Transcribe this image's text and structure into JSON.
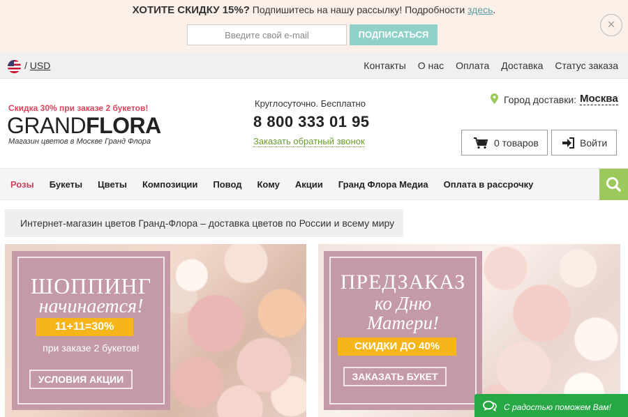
{
  "promo": {
    "headline": "ХОТИТЕ СКИДКУ 15%?",
    "text": "Подпишитесь на нашу рассылку! Подробности",
    "link": "здесь",
    "suffix": ".",
    "email_placeholder": "Введите свой e-mail",
    "subscribe_label": "ПОДПИСАТЬСЯ",
    "close_label": "×"
  },
  "topbar": {
    "separator": "/",
    "currency": "USD",
    "links": [
      "Контакты",
      "О нас",
      "Оплата",
      "Доставка",
      "Статус заказа"
    ]
  },
  "header": {
    "sale_note": "Скидка 30% при заказе 2 букетов!",
    "logo_light": "GRAND",
    "logo_bold": "FLORA",
    "logo_sub": "Магазин цветов в Москве Гранд Флора",
    "hours": "Круглосуточно. Бесплатно",
    "phone": "8 800 333 01 95",
    "callback": "Заказать обратный звонок",
    "city_label": "Город доставки:",
    "city": "Москва",
    "cart_label": "0 товаров",
    "login_label": "Войти"
  },
  "nav": {
    "items": [
      "Розы",
      "Букеты",
      "Цветы",
      "Композиции",
      "Повод",
      "Кому",
      "Акции",
      "Гранд Флора Медиа",
      "Оплата в рассрочку"
    ]
  },
  "breadcrumb": "Интернет-магазин цветов Гранд-Флора – доставка цветов по России и всему миру",
  "banners": [
    {
      "title_1": "ШОППИНГ",
      "title_2": "начинается!",
      "badge": "11+11=30%",
      "subtitle": "при заказе 2 букетов!",
      "button": "УСЛОВИЯ АКЦИИ"
    },
    {
      "title_1": "ПРЕДЗАКАЗ",
      "title_2": "ко Дню",
      "title_3": "Матери!",
      "badge": "СКИДКИ ДО 40%",
      "button": "ЗАКАЗАТЬ БУКЕТ"
    }
  ],
  "chat": {
    "label": "С радостью поможем Вам!"
  },
  "colors": {
    "promo_bg": "#fbf0e8",
    "subscribe_btn": "#8fd0c8",
    "accent_pink": "#d9445a",
    "callback_green": "#6a9d2f",
    "search_green": "#9cc95c",
    "banner_panel": "#c49aa6",
    "badge_yellow": "#f6b51b",
    "chat_green": "#28a745"
  },
  "icons": [
    "close-icon",
    "us-flag-icon",
    "location-pin-icon",
    "cart-icon",
    "login-icon",
    "search-icon",
    "chat-icon"
  ]
}
